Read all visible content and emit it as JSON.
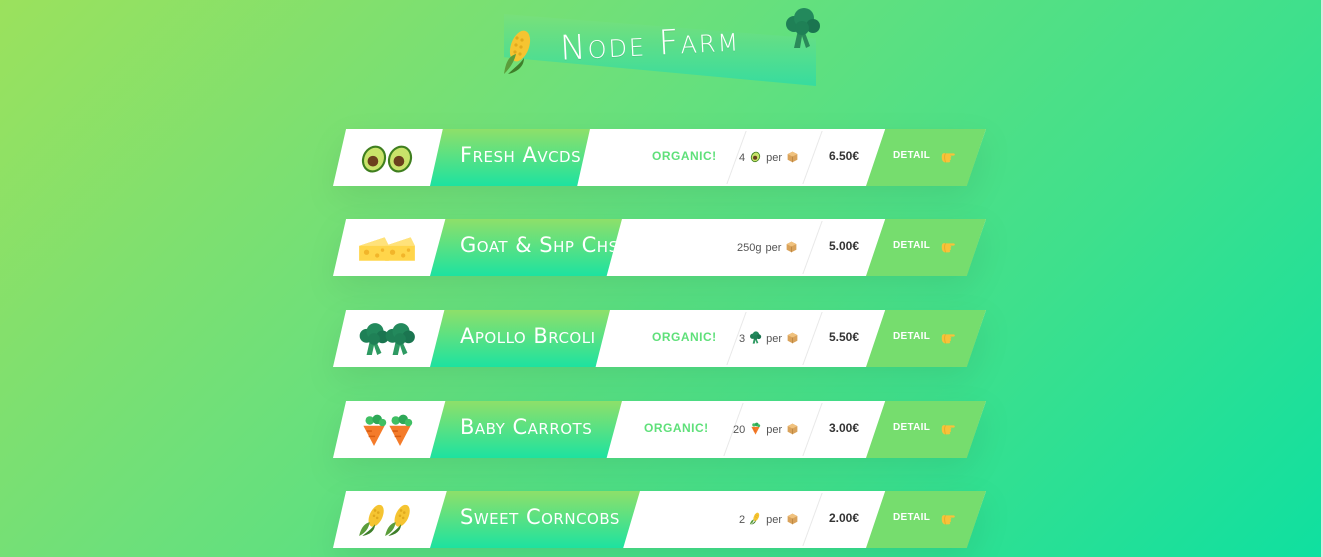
{
  "header": {
    "title": "Node Farm",
    "left_icon": "corn-icon",
    "right_icon": "broccoli-icon"
  },
  "colors": {
    "accent_green": "#76dd6e",
    "organic_text": "#5fe07a",
    "band_top": "#8ee06a",
    "band_bottom": "#1de2a0"
  },
  "products": [
    {
      "name": "Fresh Avcds",
      "organic": "ORGANIC!",
      "qty_number": "4",
      "qty_icon": "avocado-icon",
      "per_label": "per",
      "price": "6.50€",
      "detail_label": "DETAIL",
      "emoji": "avocado-icon"
    },
    {
      "name": "Goat & Shp Chs",
      "organic": "",
      "qty_number": "250g",
      "qty_icon": "",
      "per_label": "per",
      "price": "5.00€",
      "detail_label": "DETAIL",
      "emoji": "cheese-icon"
    },
    {
      "name": "Apollo Brcoli",
      "organic": "ORGANIC!",
      "qty_number": "3",
      "qty_icon": "broccoli-icon",
      "per_label": "per",
      "price": "5.50€",
      "detail_label": "DETAIL",
      "emoji": "broccoli-icon"
    },
    {
      "name": "Baby Carrots",
      "organic": "ORGANIC!",
      "qty_number": "20",
      "qty_icon": "carrot-icon",
      "per_label": "per",
      "price": "3.00€",
      "detail_label": "DETAIL",
      "emoji": "carrot-icon"
    },
    {
      "name": "Sweet Corncobs",
      "organic": "",
      "qty_number": "2",
      "qty_icon": "corn-icon",
      "per_label": "per",
      "price": "2.00€",
      "detail_label": "DETAIL",
      "emoji": "corn-icon"
    }
  ]
}
